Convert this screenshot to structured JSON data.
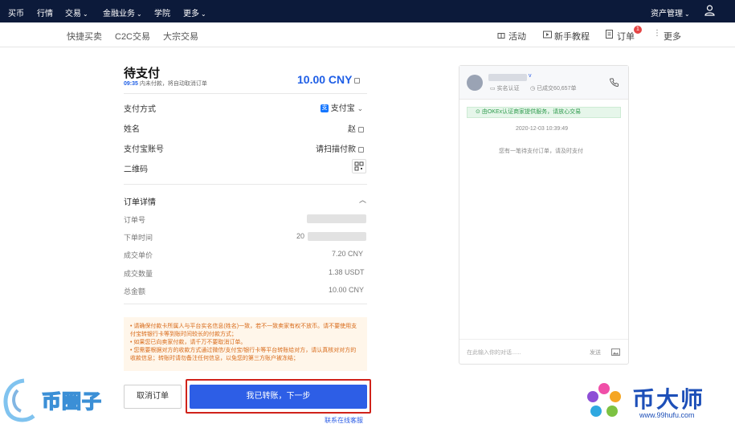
{
  "topbar": {
    "items": [
      "买币",
      "行情",
      "交易",
      "金融业务",
      "学院",
      "更多"
    ],
    "asset_mgmt": "资产管理"
  },
  "subnav": {
    "items": [
      "快捷买卖",
      "C2C交易",
      "大宗交易"
    ],
    "right_items": [
      "活动",
      "新手教程",
      "订单",
      "更多"
    ],
    "order_badge": "1"
  },
  "order": {
    "title": "待支付",
    "timer": "09:35",
    "timer_text": "内未付款，将自动取消订单",
    "amount": "10.00 CNY",
    "payment_method_label": "支付方式",
    "payment_method_value": "支付宝",
    "name_label": "姓名",
    "name_value": "赵",
    "account_label": "支付宝账号",
    "account_value": "请扫描付款",
    "qr_label": "二维码",
    "details_title": "订单详情",
    "order_no_label": "订单号",
    "order_time_label": "下单时间",
    "order_time_prefix": "20",
    "unit_price_label": "成交单价",
    "unit_price_value": "7.20 CNY",
    "qty_label": "成交数量",
    "qty_value": "1.38 USDT",
    "total_label": "总金额",
    "total_value": "10.00 CNY"
  },
  "notice": [
    "请确保付款卡所属人与平台实名信息(姓名)一致，若不一致卖家有权不放币。请不要使用支付宝转银行卡等到账时间较长的付款方式；",
    "如果您已向卖家付款，请千万不要取消订单。",
    "您需要根据对方的收款方式通过微信/支付宝/银行卡等平台转账给对方，请认真核对对方的收款信息；转账时请勿备注任何信息，以免您的第三方账户被冻结；"
  ],
  "buttons": {
    "cancel": "取消订单",
    "confirm": "我已转账，下一步",
    "support": "联系在线客服"
  },
  "chat": {
    "verified": "实名认证",
    "trades": "已成交60,657单",
    "security_note": "由OKEx认证商家提供服务，请放心交易",
    "timestamp": "2020-12-03 10:39:49",
    "system_msg": "您有一笔待支付订单，请及时支付",
    "input_placeholder": "在此输入你的对话......",
    "send": "发送"
  },
  "watermarks": {
    "left_text": "币圈子",
    "right_text": "币大师",
    "right_url": "www.99hufu.com"
  },
  "colors": {
    "topbar_bg": "#0c1a3a",
    "accent_blue": "#2d5ee6",
    "highlight_red": "#d0221a",
    "notice_orange": "#d86b1a",
    "success_green": "#2c9a4b"
  }
}
